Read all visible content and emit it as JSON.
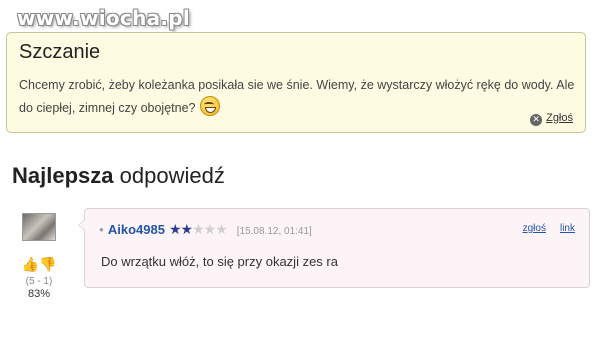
{
  "watermark": "www.wiocha.pl",
  "question": {
    "title": "Szczanie",
    "text": "Chcemy zrobić, żeby koleżanka posikała sie we śnie. Wiemy, że wystarczy włożyć rękę do wody. Ale do ciepłej, zimnej czy obojętne?",
    "report_label": "Zgłoś",
    "smiley_icon": "grin-smiley-icon"
  },
  "best_answer": {
    "heading_bold": "Najlepsza",
    "heading_rest": "odpowiedź",
    "user": "Aiko4985",
    "rating": {
      "filled": 2,
      "total": 5
    },
    "date": "[15.08.12, 01:41]",
    "report_label": "zgłoś",
    "link_label": "link",
    "text": "Do wrzątku włóż, to się przy okazji zes ra",
    "votes": {
      "count_text": "(5 - 1)",
      "percent": "83%"
    }
  },
  "colors": {
    "question_bg": "#fdfbe2",
    "answer_bg": "#fdf4f8",
    "username": "#2255aa",
    "star_filled": "#2c3e8c"
  }
}
